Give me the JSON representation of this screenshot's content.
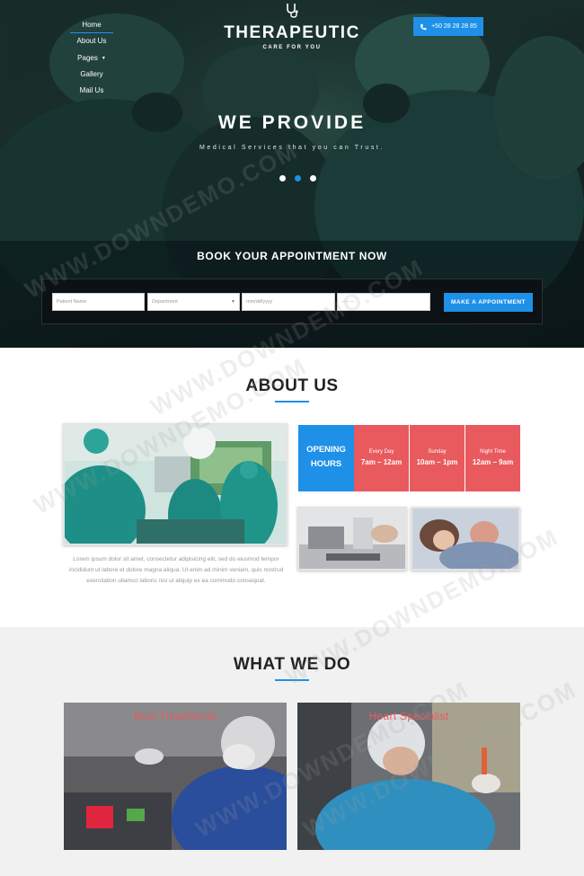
{
  "nav": {
    "items": [
      {
        "label": "Home"
      },
      {
        "label": "About Us"
      },
      {
        "label": "Pages"
      },
      {
        "label": "Gallery"
      },
      {
        "label": "Mail Us"
      }
    ]
  },
  "brand": {
    "title": "THERAPEUTIC",
    "subtitle": "CARE FOR YOU",
    "icon": "stethoscope-icon"
  },
  "phone": {
    "label": "+50 28 28 28 85",
    "icon": "phone-icon"
  },
  "hero": {
    "title": "WE PROVIDE",
    "subtitle": "Medical Services that you can Trust.",
    "slides": 3,
    "active_slide": 2
  },
  "booking": {
    "title": "BOOK YOUR APPOINTMENT NOW",
    "name_placeholder": "Patient Name",
    "department_placeholder": "Department",
    "date_placeholder": "mm/dd/yyyy",
    "time_placeholder": "--:-- --",
    "submit_label": "MAKE A APPOINTMENT"
  },
  "about": {
    "title": "ABOUT US",
    "text": "Lorem ipsum dolor sit amet, consectetur adipisicing elit, sed do eiusmod tempor incididunt ut labore et dolore magna aliqua. Ut enim ad minim veniam, quis nostrud exercitation ullamco laboris nisi ut aliquip ex ea commodo consequat.",
    "opening_label": "OPENING HOURS",
    "hours": [
      {
        "day": "Every Day",
        "time": "7am – 12am"
      },
      {
        "day": "Sunday",
        "time": "10am – 1pm"
      },
      {
        "day": "Night Time",
        "time": "12am – 9am"
      }
    ]
  },
  "services": {
    "title": "WHAT WE DO",
    "items": [
      {
        "title": "Best Treatments"
      },
      {
        "title": "Heart Specialist"
      }
    ]
  },
  "watermark": "WWW.DOWNDEMO.COM",
  "colors": {
    "accent": "#1e90e8",
    "hours_red": "#e85a5e",
    "section_gray": "#f1f1f1"
  }
}
